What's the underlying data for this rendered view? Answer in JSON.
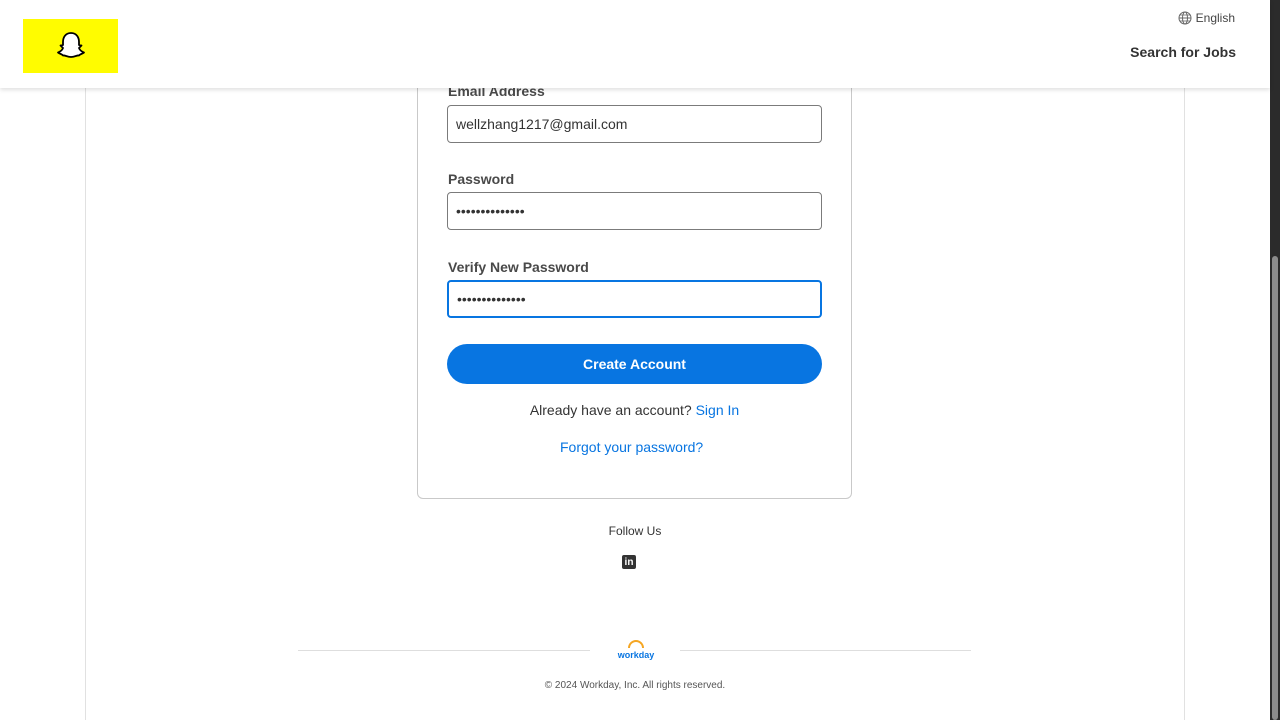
{
  "header": {
    "language": "English",
    "search_jobs": "Search for Jobs",
    "brand_color": "#fffc00"
  },
  "form": {
    "email_label": "Email Address",
    "email_value": "wellzhang1217@gmail.com",
    "password_label": "Password",
    "password_value": "••••••••••••••",
    "verify_label": "Verify New Password",
    "verify_value": "••••••••••••••",
    "create_button": "Create Account",
    "already_text": "Already have an account?",
    "sign_in": "Sign In",
    "forgot_password": "Forgot your password?",
    "accent_color": "#0875e1"
  },
  "footer": {
    "follow_us": "Follow Us",
    "linkedin_icon": "in",
    "workday_logo": "workday",
    "copyright": "© 2024 Workday, Inc. All rights reserved."
  }
}
